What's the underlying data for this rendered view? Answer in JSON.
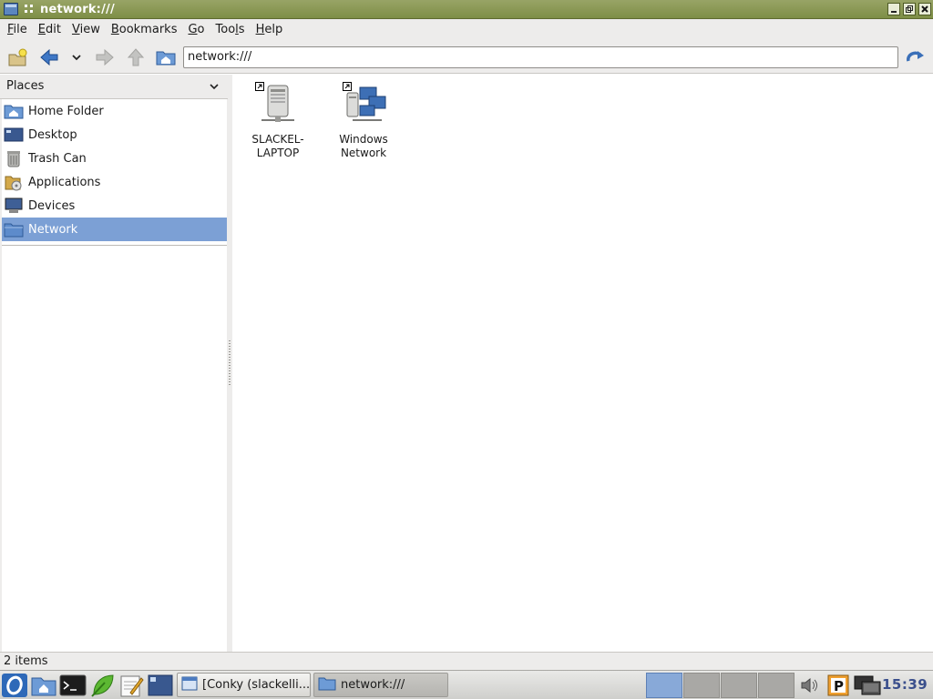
{
  "window": {
    "title": "network:///",
    "controls": {
      "minimize": "minimize-icon",
      "maximize": "maximize-icon",
      "close": "close-icon"
    }
  },
  "menubar": {
    "items": [
      {
        "label": "File",
        "mnemonic": "F",
        "rest": "ile"
      },
      {
        "label": "Edit",
        "mnemonic": "E",
        "rest": "dit"
      },
      {
        "label": "View",
        "mnemonic": "V",
        "rest": "iew"
      },
      {
        "label": "Bookmarks",
        "mnemonic": "B",
        "rest": "ookmarks"
      },
      {
        "label": "Go",
        "mnemonic": "G",
        "rest": "o"
      },
      {
        "label": "Tools",
        "pre": "Too",
        "mnemonic": "l",
        "rest": "s"
      },
      {
        "label": "Help",
        "mnemonic": "H",
        "rest": "elp"
      }
    ]
  },
  "toolbar": {
    "address": "network:///",
    "icons": [
      "new-folder-icon",
      "back-arrow-icon",
      "history-dropdown-icon",
      "forward-arrow-icon",
      "up-arrow-icon",
      "home-folder-icon",
      "reload-icon"
    ]
  },
  "sidebar": {
    "header": "Places",
    "items": [
      {
        "label": "Home Folder",
        "icon": "home-folder-icon",
        "selected": false
      },
      {
        "label": "Desktop",
        "icon": "desktop-icon",
        "selected": false
      },
      {
        "label": "Trash Can",
        "icon": "trash-can-icon",
        "selected": false
      },
      {
        "label": "Applications",
        "icon": "applications-icon",
        "selected": false
      },
      {
        "label": "Devices",
        "icon": "devices-icon",
        "selected": false
      },
      {
        "label": "Network",
        "icon": "network-folder-icon",
        "selected": true
      }
    ]
  },
  "content": {
    "items": [
      {
        "line1": "SLACKEL-",
        "line2": "LAPTOP",
        "icon": "server-icon",
        "shortcut": true
      },
      {
        "line1": "Windows",
        "line2": "Network",
        "icon": "windows-network-icon",
        "shortcut": true
      }
    ]
  },
  "statusbar": {
    "text": "2 items"
  },
  "taskbar": {
    "launchers": [
      "start-menu-icon",
      "file-manager-icon",
      "terminal-icon",
      "browser-icon",
      "text-editor-icon",
      "show-desktop-icon"
    ],
    "tasks": [
      {
        "label": "[Conky (slackelli...",
        "icon": "window-icon",
        "active": false
      },
      {
        "label": "network:///",
        "icon": "folder-icon",
        "active": true
      }
    ],
    "workspaces": [
      1,
      2,
      3,
      4
    ],
    "active_workspace": 1,
    "tray": [
      "volume-icon",
      "parking-icon",
      "network-status-icon"
    ],
    "clock": "15:39"
  },
  "colors": {
    "titlebar": "#8a9a52",
    "selection": "#7ca0d5",
    "clock": "#3a4f8c"
  }
}
